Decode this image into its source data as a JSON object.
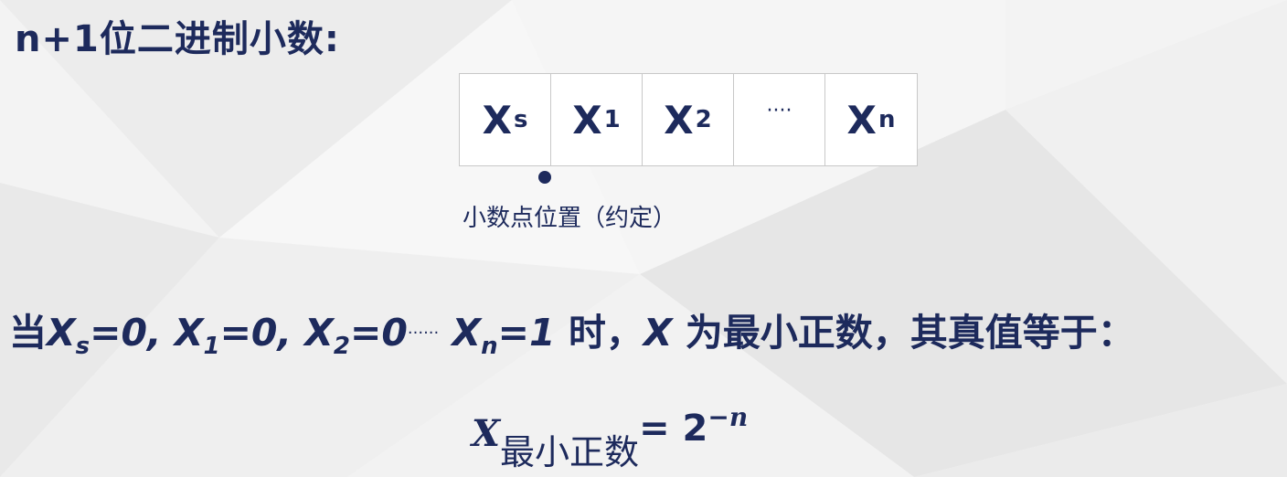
{
  "title": "n+1位二进制小数:",
  "bit_cells": [
    {
      "base": "X",
      "sub": "s"
    },
    {
      "base": "X",
      "sub": "1"
    },
    {
      "base": "X",
      "sub": "2"
    },
    {
      "base": "····",
      "sub": ""
    },
    {
      "base": "X",
      "sub": "n"
    }
  ],
  "point_label": "小数点位置（约定）",
  "condition": {
    "lead": "当",
    "x": "X",
    "s": "s",
    "eq0": "=0, ",
    "one": "1",
    "two": "2",
    "dots": "······",
    "n": "n",
    "eq1": "=1",
    "tail1": " 时，",
    "tail2": " 为最小正数，其真值等于："
  },
  "formula": {
    "var": "X",
    "sub": "最小正数",
    "eq": "= ",
    "base": "2",
    "exp": "−n"
  },
  "colors": {
    "text": "#1d2a5c",
    "background": "#f3f3f3",
    "cell_border": "#c8c8c8"
  }
}
